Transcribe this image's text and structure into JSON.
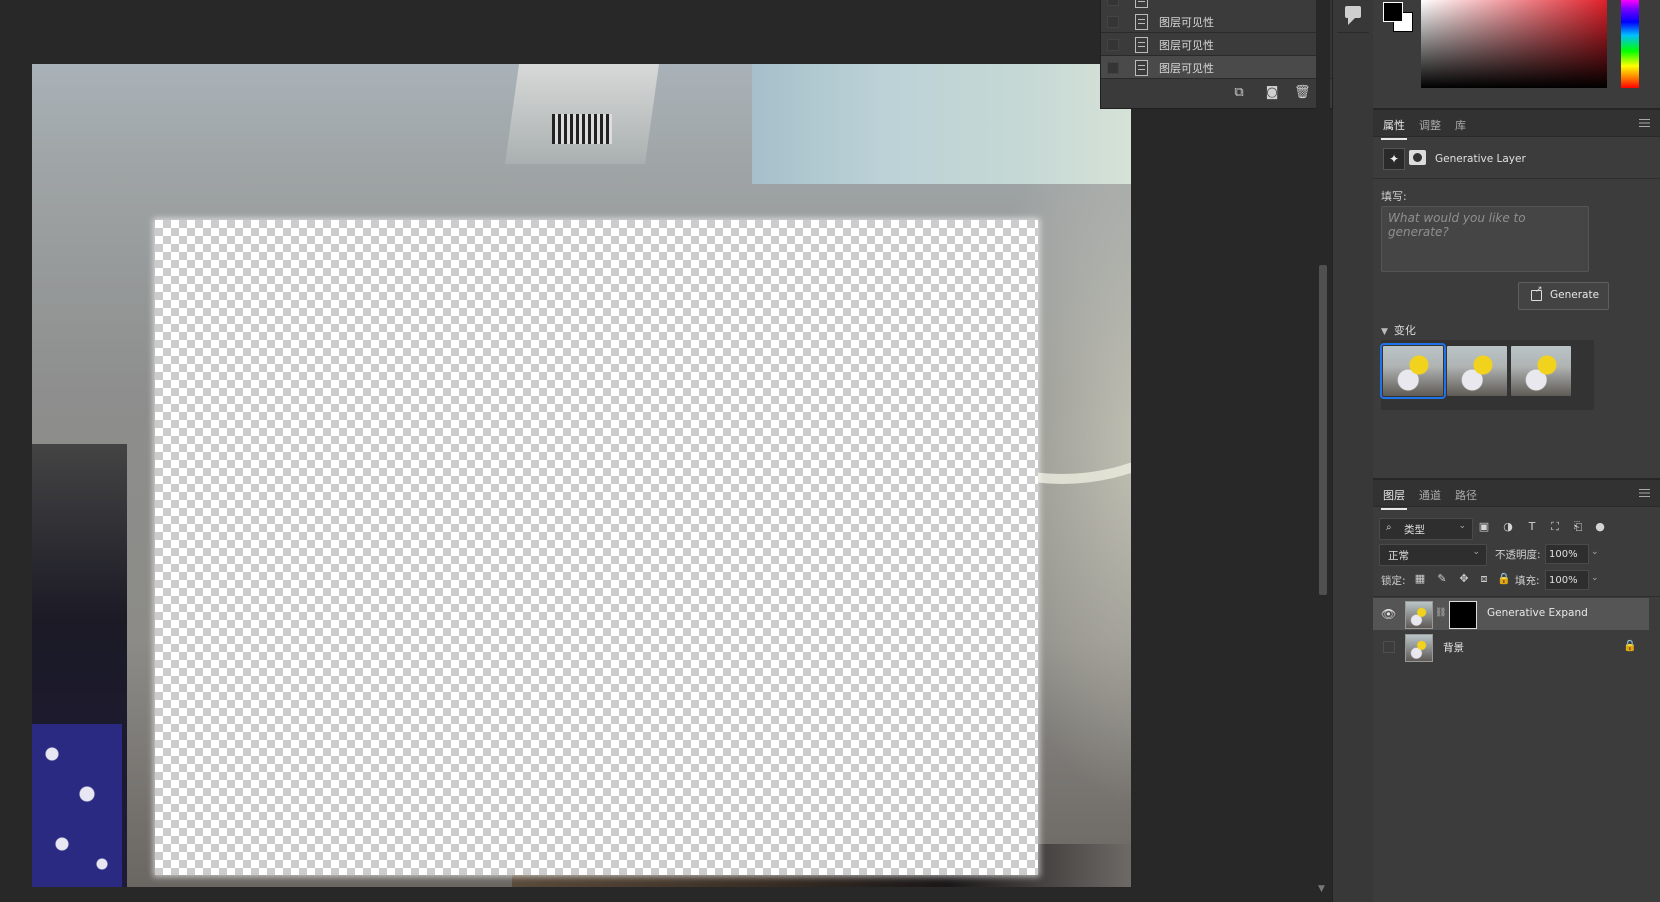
{
  "history": {
    "items": [
      "图层可见性",
      "图层可见性",
      "图层可见性"
    ],
    "footer_icons": [
      "new-document-from-state-icon",
      "camera-icon",
      "trash-icon"
    ]
  },
  "properties": {
    "tabs": [
      "属性",
      "调整",
      "库"
    ],
    "active_tab": "属性",
    "layer_type": "Generative Layer",
    "prompt_label": "填写:",
    "prompt_placeholder": "What would you like to generate?",
    "generate_label": "Generate",
    "variations_label": "变化",
    "variations_count": 3,
    "selected_variation": 1
  },
  "layers_panel": {
    "tabs": [
      "图层",
      "通道",
      "路径"
    ],
    "active_tab": "图层",
    "filter_label": "类型",
    "blend_mode": "正常",
    "opacity_label": "不透明度:",
    "opacity_value": "100%",
    "lock_label": "锁定:",
    "fill_label": "填充:",
    "fill_value": "100%",
    "layers": [
      {
        "name": "Generative Expand",
        "visible": true,
        "selected": true,
        "has_mask": true
      },
      {
        "name": "背景",
        "visible": false,
        "selected": false,
        "locked": true
      }
    ]
  },
  "colors": {
    "foreground": "#000000",
    "background": "#ffffff",
    "selection_accent": "#1e73e8"
  }
}
